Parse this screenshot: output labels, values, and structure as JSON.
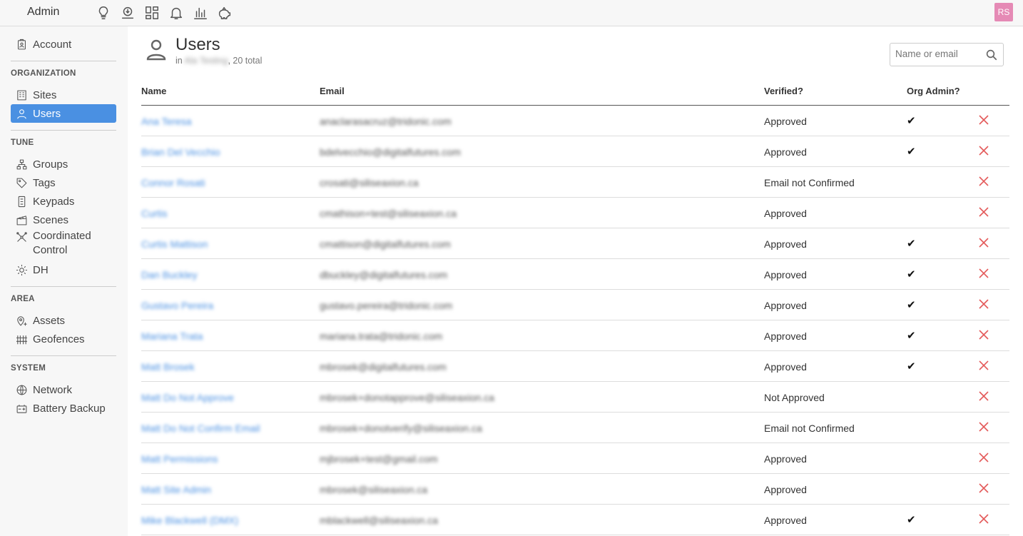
{
  "header": {
    "title": "Admin",
    "icons": [
      "lightbulb-icon",
      "download-icon",
      "dashboard-icon",
      "bell-icon",
      "bar-chart-icon",
      "piggy-bank-icon"
    ],
    "avatar_initials": "RS",
    "avatar_color": "#e58ab5"
  },
  "sidebar": {
    "account": "Account",
    "sections": {
      "organization": "ORGANIZATION",
      "tune": "TUNE",
      "area": "AREA",
      "system": "SYSTEM"
    },
    "items": {
      "sites": "Sites",
      "users": "Users",
      "groups": "Groups",
      "tags": "Tags",
      "keypads": "Keypads",
      "scenes": "Scenes",
      "coordinated": "Coordinated Control",
      "dh": "DH",
      "assets": "Assets",
      "geofences": "Geofences",
      "network": "Network",
      "battery": "Battery Backup"
    },
    "active_color": "#4a90e2"
  },
  "main": {
    "title": "Users",
    "subtitle_prefix": "in ",
    "subtitle_org": "Ala Testing",
    "subtitle_suffix": ", 20 total",
    "search": {
      "placeholder": "Name or email",
      "value": ""
    },
    "columns": {
      "name": "Name",
      "email": "Email",
      "verified": "Verified?",
      "org_admin": "Org Admin?"
    },
    "rows": [
      {
        "name": "Ana Teresa",
        "email": "anaclarasacruz@tridonic.com",
        "verified": "Approved",
        "admin": "✔"
      },
      {
        "name": "Brian Del Vecchio",
        "email": "bdelvecchio@digitalfutures.com",
        "verified": "Approved",
        "admin": "✔"
      },
      {
        "name": "Connor Rosati",
        "email": "crosati@siliseaxion.ca",
        "verified": "Email not Confirmed",
        "admin": ""
      },
      {
        "name": "Curtis",
        "email": "cmathison+test@siliseaxion.ca",
        "verified": "Approved",
        "admin": ""
      },
      {
        "name": "Curtis Mattison",
        "email": "cmattison@digitalfutures.com",
        "verified": "Approved",
        "admin": "✔"
      },
      {
        "name": "Dan Buckley",
        "email": "dbuckley@digitalfutures.com",
        "verified": "Approved",
        "admin": "✔"
      },
      {
        "name": "Gustavo Pereira",
        "email": "gustavo.pereira@tridonic.com",
        "verified": "Approved",
        "admin": "✔"
      },
      {
        "name": "Mariana Trata",
        "email": "mariana.trata@tridonic.com",
        "verified": "Approved",
        "admin": "✔"
      },
      {
        "name": "Matt Brosek",
        "email": "mbrosek@digitalfutures.com",
        "verified": "Approved",
        "admin": "✔"
      },
      {
        "name": "Matt Do Not Approve",
        "email": "mbrosek+donotapprove@siliseaxion.ca",
        "verified": "Not Approved",
        "admin": ""
      },
      {
        "name": "Matt Do Not Confirm Email",
        "email": "mbrosek+donotverify@siliseaxion.ca",
        "verified": "Email not Confirmed",
        "admin": ""
      },
      {
        "name": "Matt Permissions",
        "email": "mjbrosek+test@gmail.com",
        "verified": "Approved",
        "admin": ""
      },
      {
        "name": "Matt Site Admin",
        "email": "mbrosek@siliseaxion.ca",
        "verified": "Approved",
        "admin": ""
      },
      {
        "name": "Mike Blackwell (DMX)",
        "email": "mblackwell@siliseaxion.ca",
        "verified": "Approved",
        "admin": "✔"
      }
    ],
    "delete_color": "#e45a5a"
  }
}
